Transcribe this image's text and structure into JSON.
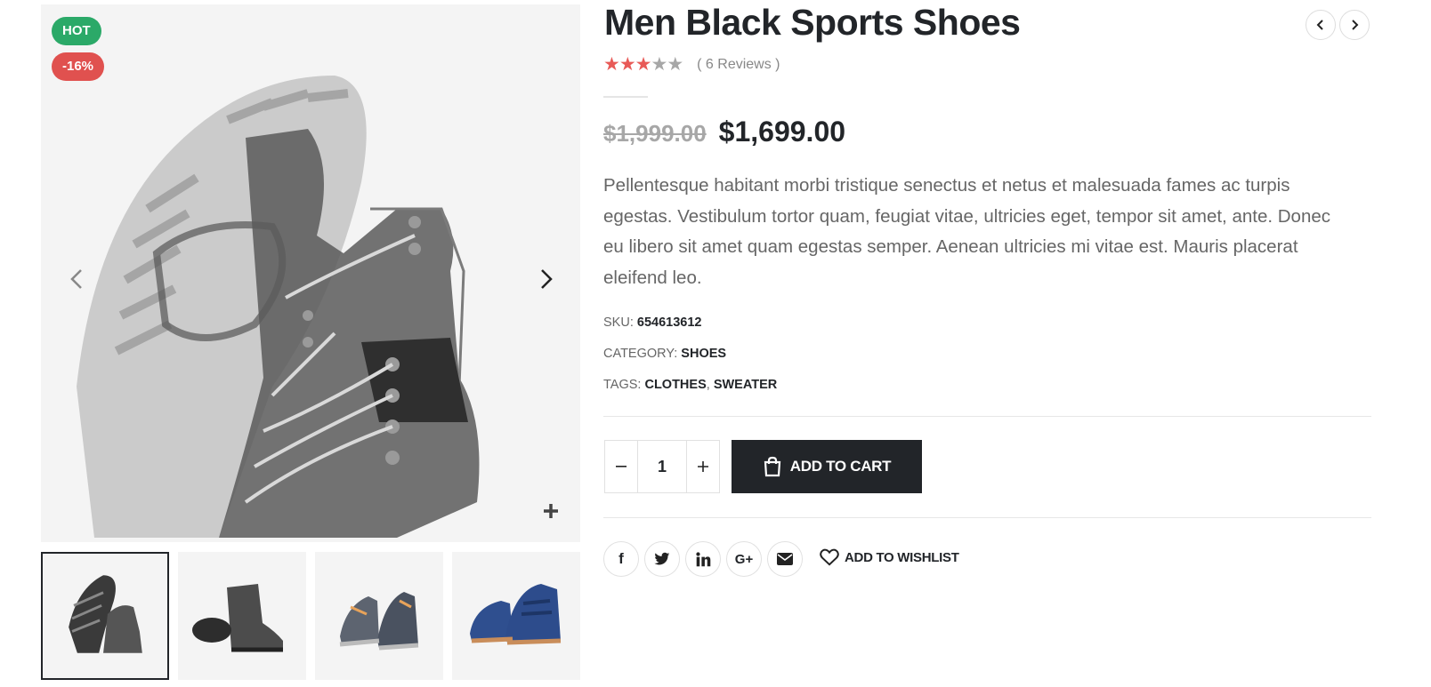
{
  "gallery": {
    "badges": {
      "hot": "HOT",
      "sale": "-16%"
    },
    "thumbnails": [
      "thumb-boots-sole",
      "thumb-boot-side",
      "thumb-sneakers-grey",
      "thumb-sneakers-blue"
    ]
  },
  "product": {
    "title": "Men Black Sports Shoes",
    "rating_value": 3,
    "rating_max": 5,
    "reviews": "( 6 Reviews )",
    "old_price": "$1,999.00",
    "price": "$1,699.00",
    "description": "Pellentesque habitant morbi tristique senectus et netus et malesuada fames ac turpis egestas. Vestibulum tortor quam, feugiat vitae, ultricies eget, tempor sit amet, ante. Donec eu libero sit amet quam egestas semper. Aenean ultricies mi vitae est. Mauris placerat eleifend leo.",
    "meta": {
      "sku_label": "SKU:",
      "sku": "654613612",
      "category_label": "CATEGORY:",
      "category": "SHOES",
      "tags_label": "TAGS:",
      "tags": [
        "CLOTHES",
        "SWEATER"
      ]
    },
    "quantity": "1",
    "add_to_cart": "ADD TO CART",
    "wishlist": "ADD TO WISHLIST",
    "share": {
      "facebook": "f",
      "google_plus": "G+"
    }
  },
  "colors": {
    "hot_badge": "#2ba968",
    "sale_badge": "#e0514f",
    "star_active": "#e85a57",
    "dark": "#222529"
  }
}
